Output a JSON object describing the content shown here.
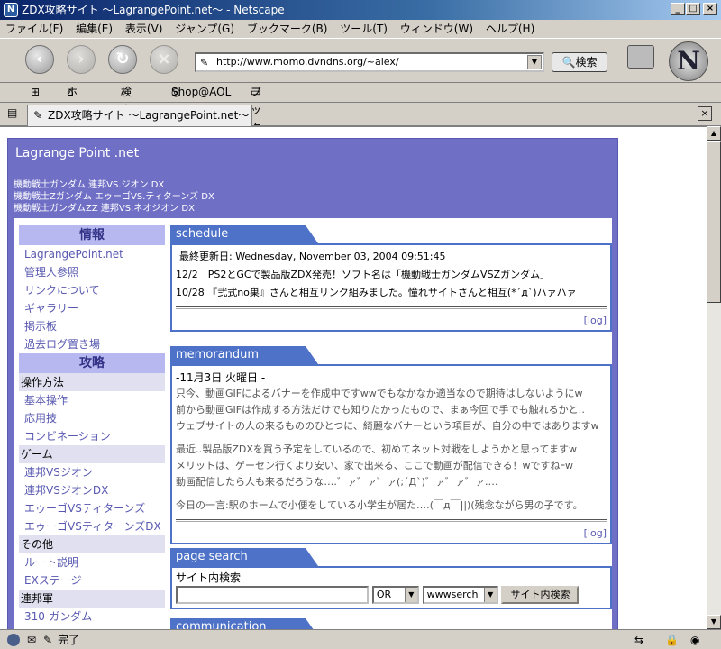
{
  "window": {
    "title": "ZDX攻略サイト 〜LagrangePoint.net〜 - Netscape",
    "min": "_",
    "max": "□",
    "close": "×",
    "app_icon": "N"
  },
  "menu": [
    "ファイル(F)",
    "編集(E)",
    "表示(V)",
    "ジャンプ(G)",
    "ブックマーク(B)",
    "ツール(T)",
    "ウィンドウ(W)",
    "ヘルプ(H)"
  ],
  "toolbar": {
    "url": "http://www.momo.dvndns.org/~alex/",
    "search_label": "検索",
    "logo": "N"
  },
  "personal": {
    "home": "ホーム",
    "search": "検索",
    "shop": "Shop@AOL",
    "bookmarks": "ブックマーク"
  },
  "tab": {
    "label": "ZDX攻略サイト 〜LagrangePoint.net〜",
    "close": "×"
  },
  "site": {
    "title": "Lagrange Point .net",
    "subtitles": [
      "機動戦士ガンダム 連邦VS.ジオン DX",
      "機動戦士Zガンダム エゥーゴVS.ティターンズ DX",
      "機動戦士ガンダムZZ 連邦VS.ネオジオン DX"
    ]
  },
  "sidebar": {
    "info_header": "情報",
    "info_links": [
      "LagrangePoint.net",
      "管理人参照",
      "リンクについて",
      "ギャラリー",
      "掲示板",
      "過去ログ置き場"
    ],
    "guide_header": "攻略",
    "sec1": "操作方法",
    "sec1_links": [
      "基本操作",
      "応用技",
      "コンビネーション"
    ],
    "sec2": "ゲーム",
    "sec2_links": [
      "連邦VSジオン",
      "連邦VSジオンDX",
      "エゥーゴVSティターンズ",
      "エゥーゴVSティターンズDX"
    ],
    "sec3": "その他",
    "sec3_links": [
      "ルート説明",
      "EXステージ"
    ],
    "sec4": "連邦軍",
    "sec4_links": [
      "310-ガンダム"
    ]
  },
  "schedule": {
    "tab": "schedule",
    "updated": "最終更新日: Wednesday, November 03, 2004 09:51:45",
    "items": [
      "12/2　PS2とGCで製品版ZDX発売！ソフト名は「機動戦士ガンダムVSZガンダム」",
      "10/28 『弐式no巣』さんと相互リンク組みました。憧れサイトさんと相互(*´д`)ハァハァ"
    ],
    "log": "[log]"
  },
  "memo": {
    "tab": "memorandum",
    "date": "-11月3日 火曜日 -",
    "p1": [
      "只今、動画GIFによるバナーを作成中ですwwでもなかなか適当なので期待はしないようにw",
      "前から動画GIFは作成する方法だけでも知りたかったもので、まぁ今回で手でも触れるかと‥",
      "ウェブサイトの人の来るもののひとつに、綺麗なバナーという項目が、自分の中ではありますw"
    ],
    "p2": [
      "最近‥製品版ZDXを買う予定をしているので、初めてネット対戦をしようかと思ってますw",
      "メリットは、ゲーセン行くより安い、家で出来る、ここで動画が配信できる！wですねｰw",
      "動画配信したら人も来るだろうな‥‥゛ァ゛ァ゛ァ(;´Д`)゛ァ゛ァ゛ァ‥‥"
    ],
    "p3": "今日の一言:駅のホームで小便をしている小学生が居た‥‥(￣д￣||)(残念ながら男の子です。",
    "log": "[log]"
  },
  "search": {
    "tab": "page search",
    "label": "サイト内検索",
    "op": "OR",
    "engine": "wwwserch",
    "button": "サイト内検索"
  },
  "communication": {
    "tab": "communication"
  },
  "status": {
    "text": "完了"
  },
  "icons": {
    "home": "home-icon",
    "search": "magnifier-icon",
    "back": "back-arrow-icon"
  }
}
